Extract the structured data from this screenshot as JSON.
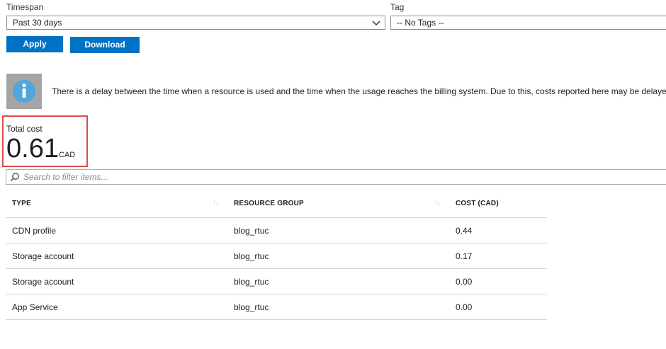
{
  "filters": {
    "timespan_label": "Timespan",
    "timespan_value": "Past 30 days",
    "tag_label": "Tag",
    "tag_value": "-- No Tags --"
  },
  "actions": {
    "apply_label": "Apply",
    "download_label": "Download"
  },
  "notice": {
    "icon": "info-icon",
    "text": "There is a delay between the time when a resource is used and the time when the usage reaches the billing system. Due to this, costs reported here may be delayed."
  },
  "total_cost": {
    "label": "Total cost",
    "value": "0.61",
    "currency": "CAD"
  },
  "search": {
    "placeholder": "Search to filter items..."
  },
  "table": {
    "headers": [
      "TYPE",
      "RESOURCE GROUP",
      "COST (CAD)"
    ],
    "rows": [
      {
        "type": "CDN profile",
        "group": "blog_rtuc",
        "cost": "0.44"
      },
      {
        "type": "Storage account",
        "group": "blog_rtuc",
        "cost": "0.17"
      },
      {
        "type": "Storage account",
        "group": "blog_rtuc",
        "cost": "0.00"
      },
      {
        "type": "App Service",
        "group": "blog_rtuc",
        "cost": "0.00"
      }
    ]
  },
  "colors": {
    "accent": "#0072c6",
    "highlight_border": "#e04a4a",
    "info_box": "#a5a5a5",
    "info_circle": "#4ea6dc"
  }
}
